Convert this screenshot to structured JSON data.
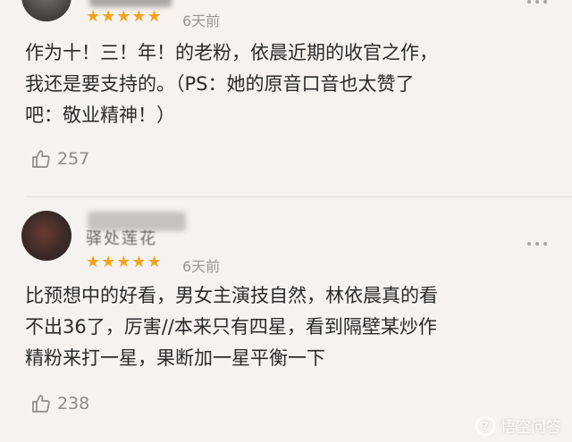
{
  "reviews": [
    {
      "stars": "★★★★★",
      "time": "6天前",
      "lines": [
        "作为十！三！年！的老粉，依晨近期的收官之作，",
        "我还是要支持的。（PS：她的原音口音也太赞了",
        "吧：敬业精神！）"
      ],
      "likes": "257"
    },
    {
      "username": "驿处莲花",
      "stars": "★★★★★",
      "time": "6天前",
      "lines": [
        "比预想中的好看，男女主演技自然，林依晨真的看",
        "不出36了，厉害//本来只有四星，看到隔壁某炒作",
        "精粉来打一星，果断加一星平衡一下"
      ],
      "likes": "238"
    }
  ],
  "watermark": {
    "text": "悟空问答"
  },
  "icons": {
    "like": "thumbs-up-icon",
    "more": "more-dots-icon",
    "star": "star-icon",
    "logo": "wukong-logo-icon"
  },
  "colors": {
    "star": "#f5a31a",
    "muted": "#9c9794",
    "background": "#f6f2ef"
  }
}
